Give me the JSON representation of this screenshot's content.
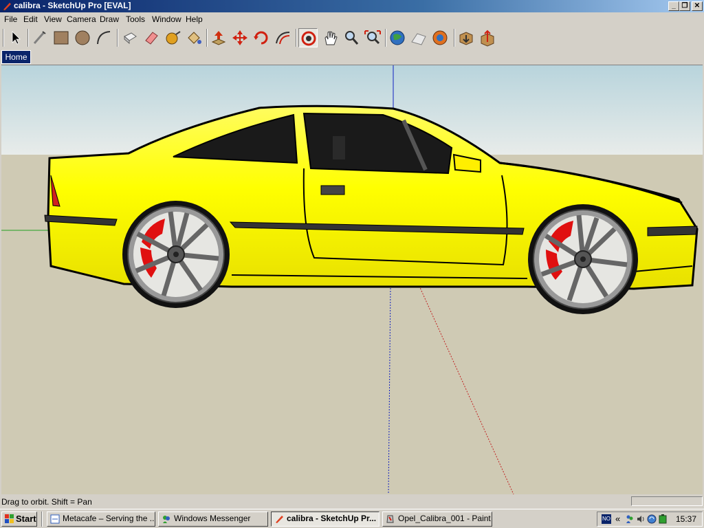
{
  "window": {
    "title": "calibra - SketchUp Pro [EVAL]"
  },
  "menu": {
    "items": [
      "File",
      "Edit",
      "View",
      "Camera",
      "Draw",
      "Tools",
      "Window",
      "Help"
    ]
  },
  "toolbar": {
    "tools": [
      "select",
      "line",
      "rectangle",
      "circle",
      "arc",
      "make-component",
      "eraser",
      "tape-measure",
      "paint-bucket",
      "push-pull",
      "move",
      "rotate",
      "offset",
      "orbit",
      "pan",
      "zoom",
      "zoom-extents",
      "get-models",
      "share-model",
      "share-component",
      "get-photo-textures",
      "add-location",
      "toggle-terrain"
    ],
    "active_tool": "orbit"
  },
  "scenes": {
    "tabs": [
      "Home"
    ]
  },
  "scene": {
    "car_color": "#ffff00",
    "caliper_color": "#e01010",
    "sky_color": "#c8dce4",
    "ground_color": "#cfcab4"
  },
  "status": {
    "text": "Drag to orbit.  Shift = Pan",
    "measurements_value": ""
  },
  "taskbar": {
    "start_label": "Start",
    "tasks": [
      "Metacafe – Serving the ...",
      "Windows Messenger",
      "calibra - SketchUp Pr...",
      "Opel_Calibra_001 - Paint"
    ],
    "active_task": "calibra - SketchUp Pr...",
    "clock": "15:37",
    "language": "NO"
  }
}
